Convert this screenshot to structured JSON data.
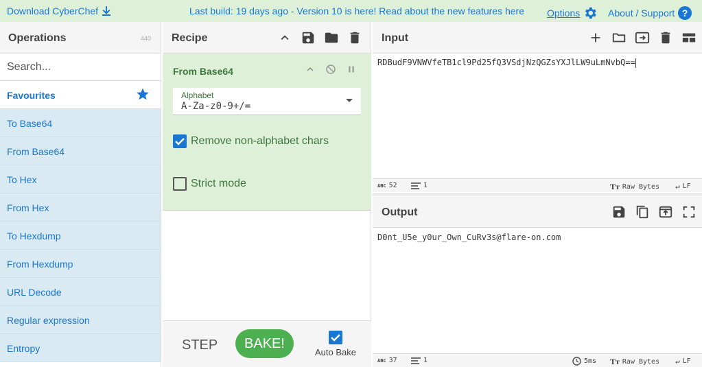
{
  "banner": {
    "download": "Download CyberChef",
    "message": "Last build: 19 days ago - Version 10 is here! Read about the new features here",
    "options": "Options",
    "about": "About / Support"
  },
  "operations": {
    "title": "Operations",
    "count": "440",
    "search_placeholder": "Search...",
    "favourites": "Favourites",
    "items": [
      "To Base64",
      "From Base64",
      "To Hex",
      "From Hex",
      "To Hexdump",
      "From Hexdump",
      "URL Decode",
      "Regular expression",
      "Entropy"
    ]
  },
  "recipe": {
    "title": "Recipe",
    "op_name": "From Base64",
    "alphabet_label": "Alphabet",
    "alphabet_value": "A-Za-z0-9+/=",
    "remove_label": "Remove non-alphabet chars",
    "remove_checked": true,
    "strict_label": "Strict mode",
    "strict_checked": false,
    "step": "STEP",
    "bake": "BAKE!",
    "auto_bake": "Auto Bake",
    "auto_bake_checked": true
  },
  "input": {
    "title": "Input",
    "text": "RDBudF9VNWVfeTB1cl9Pd25fQ3VSdjNzQGZsYXJlLW9uLmNvbQ==",
    "length": "52",
    "lines": "1",
    "encoding": "Raw Bytes",
    "eol": "LF"
  },
  "output": {
    "title": "Output",
    "text": "D0nt_U5e_y0ur_Own_CuRv3s@flare-on.com",
    "length": "37",
    "lines": "1",
    "time": "5ms",
    "encoding": "Raw Bytes",
    "eol": "LF"
  },
  "colors": {
    "accent": "#1976d2",
    "banner_bg": "#dff0d8",
    "op_bg": "#d9eaf3",
    "bake": "#4caf50"
  },
  "icons": [
    "download-icon",
    "gear-icon",
    "help-icon",
    "star-icon",
    "chevron-up-icon",
    "save-icon",
    "folder-icon",
    "trash-icon",
    "disable-icon",
    "pause-icon",
    "plus-icon",
    "input-output-icon",
    "layout-icon",
    "copy-icon",
    "open-in-input-icon",
    "maximise-icon",
    "text-format-icon",
    "return-icon",
    "clock-icon",
    "lines-icon"
  ]
}
